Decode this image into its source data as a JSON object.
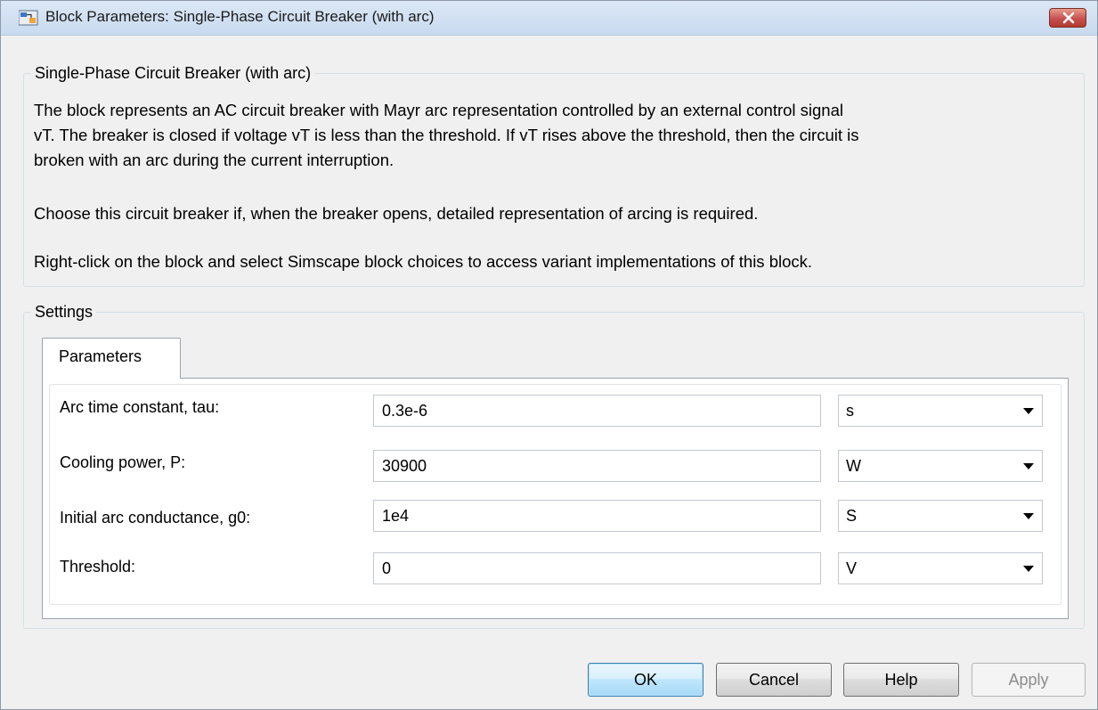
{
  "window": {
    "title": "Block Parameters: Single-Phase Circuit Breaker (with arc)"
  },
  "description": {
    "heading": "Single-Phase Circuit Breaker (with arc)",
    "line1": "The block represents an AC circuit breaker with Mayr arc representation controlled by an external control signal",
    "line2": "vT. The breaker is closed if voltage vT is less than the threshold. If vT rises above the threshold, then the circuit is",
    "line3": "broken with an arc during the current interruption.",
    "paragraph2": "Choose this circuit breaker if, when the breaker opens, detailed representation of arcing is required.",
    "paragraph3": "Right-click on the block and select Simscape block choices to access variant implementations of this block."
  },
  "settings": {
    "heading": "Settings",
    "tab_label": "Parameters",
    "params": [
      {
        "label": "Arc time constant, tau:",
        "value": "0.3e-6",
        "unit": "s"
      },
      {
        "label": "Cooling power, P:",
        "value": "30900",
        "unit": "W"
      },
      {
        "label": "Initial arc conductance, g0:",
        "value": "1e4",
        "unit": "S"
      },
      {
        "label": "Threshold:",
        "value": "0",
        "unit": "V"
      }
    ]
  },
  "buttons": {
    "ok": "OK",
    "cancel": "Cancel",
    "help": "Help",
    "apply": "Apply"
  }
}
